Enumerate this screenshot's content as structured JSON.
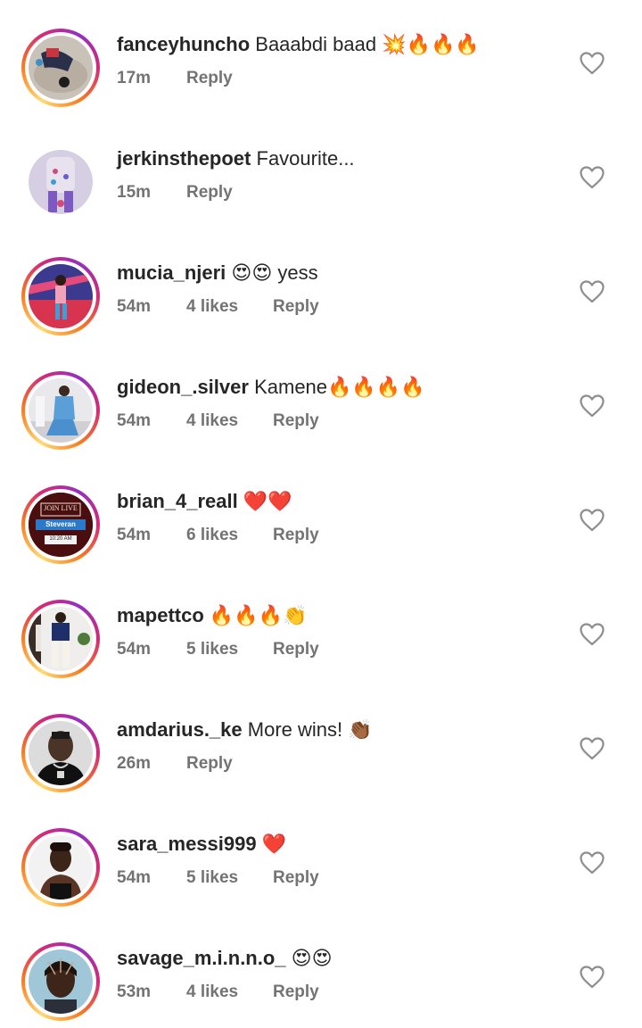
{
  "icons": {
    "like": "heart-outline-icon"
  },
  "colors": {
    "text": "#262626",
    "meta": "#737373",
    "heart": "#8e8e8e",
    "story_ring": [
      "#feda75",
      "#fa7e1e",
      "#d62976",
      "#962fbf"
    ]
  },
  "comments": [
    {
      "username": "fanceyhuncho",
      "text": "Baaabdi baad 💥🔥🔥🔥",
      "time": "17m",
      "likes": "",
      "reply": "Reply",
      "story": true
    },
    {
      "username": "jerkinsthepoet",
      "text": "Favourite...",
      "time": "15m",
      "likes": "",
      "reply": "Reply",
      "story": false
    },
    {
      "username": "mucia_njeri",
      "text": "😍😍 yess",
      "time": "54m",
      "likes": "4 likes",
      "reply": "Reply",
      "story": true
    },
    {
      "username": "gideon_.silver",
      "text": "Kamene🔥🔥🔥🔥",
      "time": "54m",
      "likes": "4 likes",
      "reply": "Reply",
      "story": true
    },
    {
      "username": "brian_4_reall",
      "text": "❤️❤️",
      "time": "54m",
      "likes": "6 likes",
      "reply": "Reply",
      "story": true,
      "avatar_text": [
        "JOIN LIVE",
        "Steveran",
        "10:20 AM"
      ]
    },
    {
      "username": "mapettco",
      "text": "🔥🔥🔥👏",
      "time": "54m",
      "likes": "5 likes",
      "reply": "Reply",
      "story": true
    },
    {
      "username": "amdarius._ke",
      "text": "More wins! 👏🏾",
      "time": "26m",
      "likes": "",
      "reply": "Reply",
      "story": true
    },
    {
      "username": "sara_messi999",
      "text": "❤️",
      "time": "54m",
      "likes": "5 likes",
      "reply": "Reply",
      "story": true
    },
    {
      "username": "savage_m.i.n.n.o_",
      "text": "😍😍",
      "time": "53m",
      "likes": "4 likes",
      "reply": "Reply",
      "story": true
    }
  ]
}
